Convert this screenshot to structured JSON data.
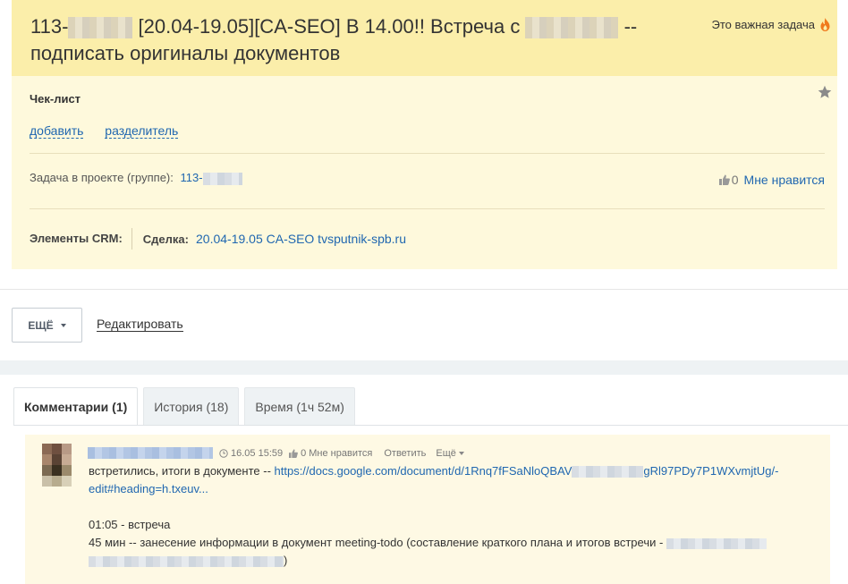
{
  "task": {
    "title_prefix": "113-",
    "title_middle": "[20.04-19.05][CA-SEO] В 14.00!! Встреча с",
    "title_suffix": "--",
    "title_line2": "подписать оригиналы документов",
    "important_label": "Это важная задача",
    "important_icon": "fire-icon"
  },
  "checklist": {
    "title": "Чек-лист",
    "add_label": "добавить",
    "separator_label": "разделитель",
    "star_icon": "star-icon"
  },
  "project": {
    "label": "Задача в проекте (группе):",
    "link_prefix": "113-",
    "like_count": "0",
    "like_label": "Мне нравится"
  },
  "crm": {
    "label": "Элементы CRM:",
    "deal_label": "Сделка:",
    "deal_link": "20.04-19.05 CA-SEO tvsputnik-spb.ru"
  },
  "actions": {
    "more_label": "ЕЩЁ",
    "edit_label": "Редактировать"
  },
  "tabs": [
    {
      "label": "Комментарии (1)"
    },
    {
      "label": "История (18)"
    },
    {
      "label": "Время (1ч 52м)"
    }
  ],
  "comment": {
    "time": "16.05 15:59",
    "like_count": "0",
    "like_label": "Мне нравится",
    "reply_label": "Ответить",
    "more_label": "Ещё",
    "text_prefix": "встретились, итоги в документе -- ",
    "link_part1": "https://docs.google.com/document/d/1Rnq7fFSaNloQBAV",
    "link_part2": "gRl97PDy7P1WXvmjtUg/-",
    "link_line2": "edit#heading=h.txeuv...",
    "line3": "01:05 - встреча",
    "line4": "45 мин -- занесение информации в документ meeting-todo (составление краткого плана и итогов встречи -",
    "line5_end": ")"
  },
  "colors": {
    "header_bg": "#fbeeaa",
    "body_bg": "#fef9dc",
    "link": "#2067b0",
    "fire": "#f07a1e"
  }
}
